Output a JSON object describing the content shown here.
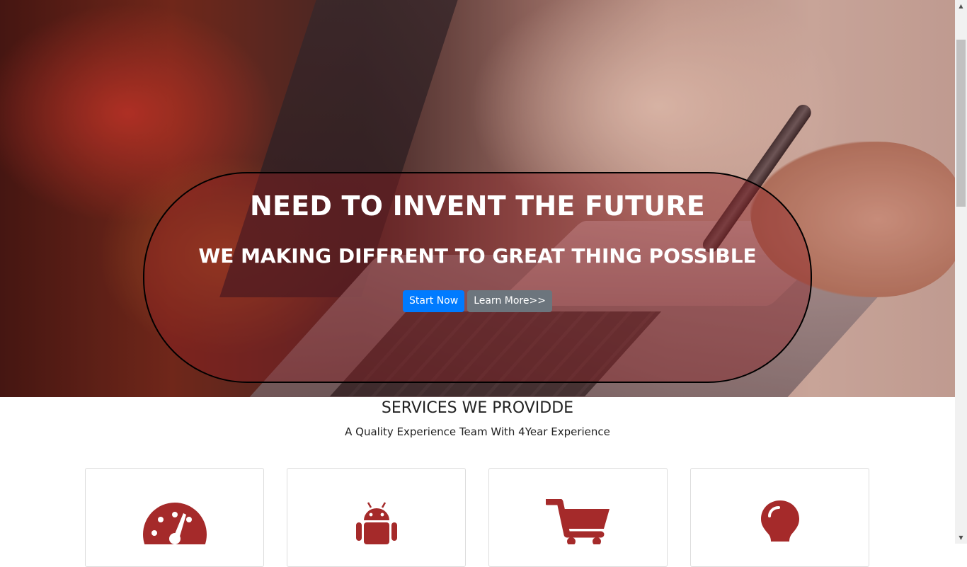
{
  "hero": {
    "title": "NEED TO INVENT THE FUTURE",
    "subtitle": "WE MAKING DIFFRENT TO GREAT THING POSSIBLE",
    "buttons": {
      "start_label": "Start Now",
      "learn_label": "Learn More>>"
    }
  },
  "services": {
    "title": "SERVICES WE PROVIDDE",
    "subtitle": "A Quality Experience Team With 4Year Experience",
    "cards": [
      {
        "icon": "speedometer-icon"
      },
      {
        "icon": "android-icon"
      },
      {
        "icon": "shopping-cart-icon"
      },
      {
        "icon": "lightbulb-icon"
      }
    ]
  },
  "colors": {
    "accent_red": "#a52a2a",
    "primary_button": "#007bff",
    "secondary_button": "#6c757d"
  },
  "scrollbar": {
    "up_arrow": "▲",
    "down_arrow": "▼"
  }
}
